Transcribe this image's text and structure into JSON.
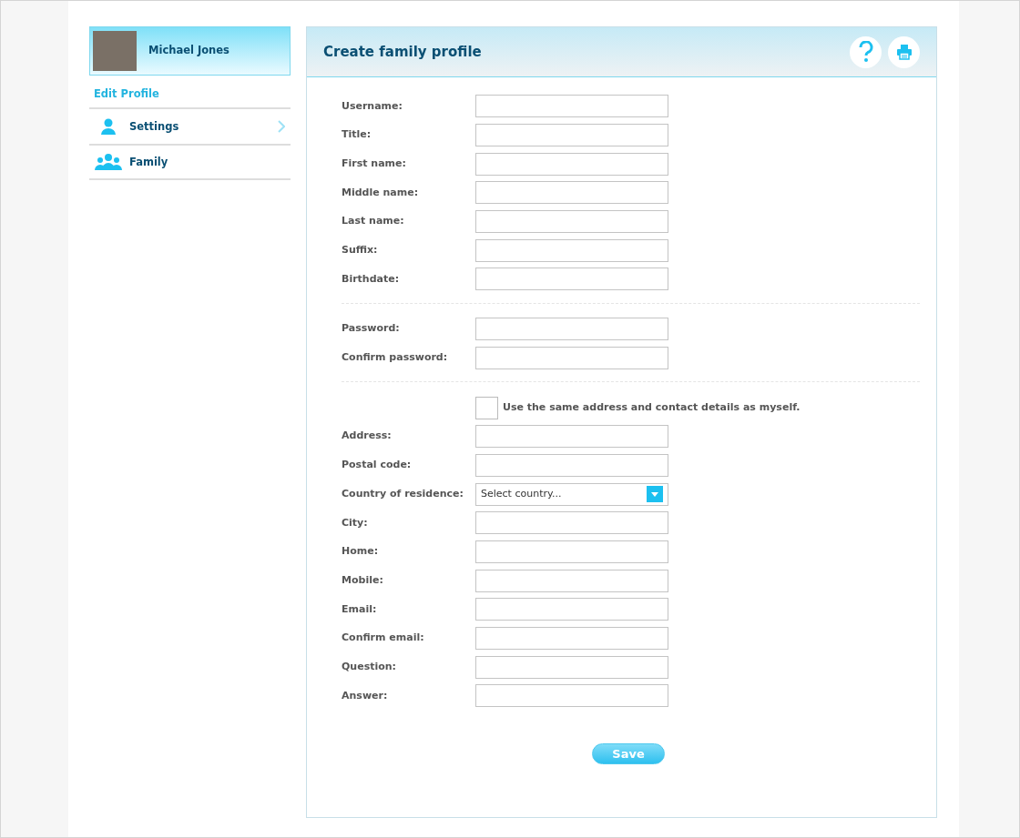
{
  "user": {
    "name": "Michael Jones"
  },
  "sidebar": {
    "edit_profile": "Edit Profile",
    "items": [
      {
        "label": "Settings",
        "kind": "person",
        "chevron": true
      },
      {
        "label": "Family",
        "kind": "group",
        "chevron": false
      }
    ]
  },
  "panel": {
    "title": "Create family profile",
    "sections": [
      [
        {
          "kind": "text",
          "label": "Username:"
        },
        {
          "kind": "text",
          "label": "Title:"
        },
        {
          "kind": "text",
          "label": "First name:"
        },
        {
          "kind": "text",
          "label": "Middle name:"
        },
        {
          "kind": "text",
          "label": "Last name:"
        },
        {
          "kind": "text",
          "label": "Suffix:"
        },
        {
          "kind": "text",
          "label": "Birthdate:"
        }
      ],
      [
        {
          "kind": "text",
          "label": "Password:"
        },
        {
          "kind": "text",
          "label": "Confirm password:"
        }
      ],
      [
        {
          "kind": "checkbox",
          "label": "Use the same address and contact details as myself.",
          "checked": false
        },
        {
          "kind": "text",
          "label": "Address:"
        },
        {
          "kind": "text",
          "label": "Postal code:"
        },
        {
          "kind": "select",
          "label": "Country of residence:",
          "placeholder": "Select country..."
        },
        {
          "kind": "text",
          "label": "City:"
        },
        {
          "kind": "text",
          "label": "Home:"
        },
        {
          "kind": "text",
          "label": "Mobile:"
        },
        {
          "kind": "text",
          "label": "Email:"
        },
        {
          "kind": "text",
          "label": "Confirm email:"
        },
        {
          "kind": "text",
          "label": "Question:"
        },
        {
          "kind": "text",
          "label": "Answer:"
        }
      ]
    ],
    "save": "Save"
  }
}
